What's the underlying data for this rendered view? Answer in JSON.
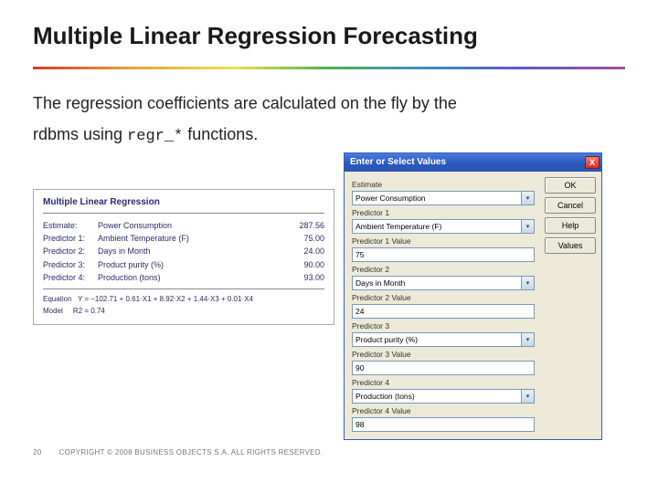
{
  "slide": {
    "title": "Multiple Linear Regression Forecasting",
    "body_line1": "The regression coefficients are calculated on the fly by the",
    "body_line2_pre": "rdbms using ",
    "body_code": "regr_*",
    "body_line2_post": " functions."
  },
  "mlr": {
    "title": "Multiple Linear Regression",
    "rows": [
      {
        "label": "Estimate:",
        "mid": "Power Consumption",
        "val": "287.56"
      },
      {
        "label": "Predictor 1:",
        "mid": "Ambient Temperature (F)",
        "val": "75.00"
      },
      {
        "label": "Predictor 2:",
        "mid": "Days in Month",
        "val": "24.00"
      },
      {
        "label": "Predictor 3:",
        "mid": "Product purity (%)",
        "val": "90.00"
      },
      {
        "label": "Predictor 4:",
        "mid": "Production (tons)",
        "val": "93.00"
      }
    ],
    "eq_label": "Equation",
    "eq": "Y = –102.71 + 0.61·X1 + 8.92·X2 + 1.44·X3 + 0.01·X4",
    "model_label": "Model",
    "model_value": "R2 =   0.74"
  },
  "dialog": {
    "title": "Enter or Select Values",
    "close": "X",
    "buttons": {
      "ok": "OK",
      "cancel": "Cancel",
      "help": "Help",
      "values": "Values"
    },
    "fields": [
      {
        "label": "Estimate",
        "kind": "select",
        "value": "Power Consumption"
      },
      {
        "label": "Predictor 1",
        "kind": "select",
        "value": "Ambient Temperature (F)"
      },
      {
        "label": "Predictor 1 Value",
        "kind": "input",
        "value": "75"
      },
      {
        "label": "Predictor 2",
        "kind": "select",
        "value": "Days in Month"
      },
      {
        "label": "Predictor 2 Value",
        "kind": "input",
        "value": "24"
      },
      {
        "label": "Predictor 3",
        "kind": "select",
        "value": "Product purity (%)"
      },
      {
        "label": "Predictor 3 Value",
        "kind": "input",
        "value": "90"
      },
      {
        "label": "Predictor 4",
        "kind": "select",
        "value": "Production (tons)"
      },
      {
        "label": "Predictor 4 Value",
        "kind": "input",
        "value": "98"
      }
    ]
  },
  "footer": {
    "page": "20",
    "copyright": "COPYRIGHT © 2008 BUSINESS OBJECTS S.A.  ALL RIGHTS RESERVED."
  }
}
